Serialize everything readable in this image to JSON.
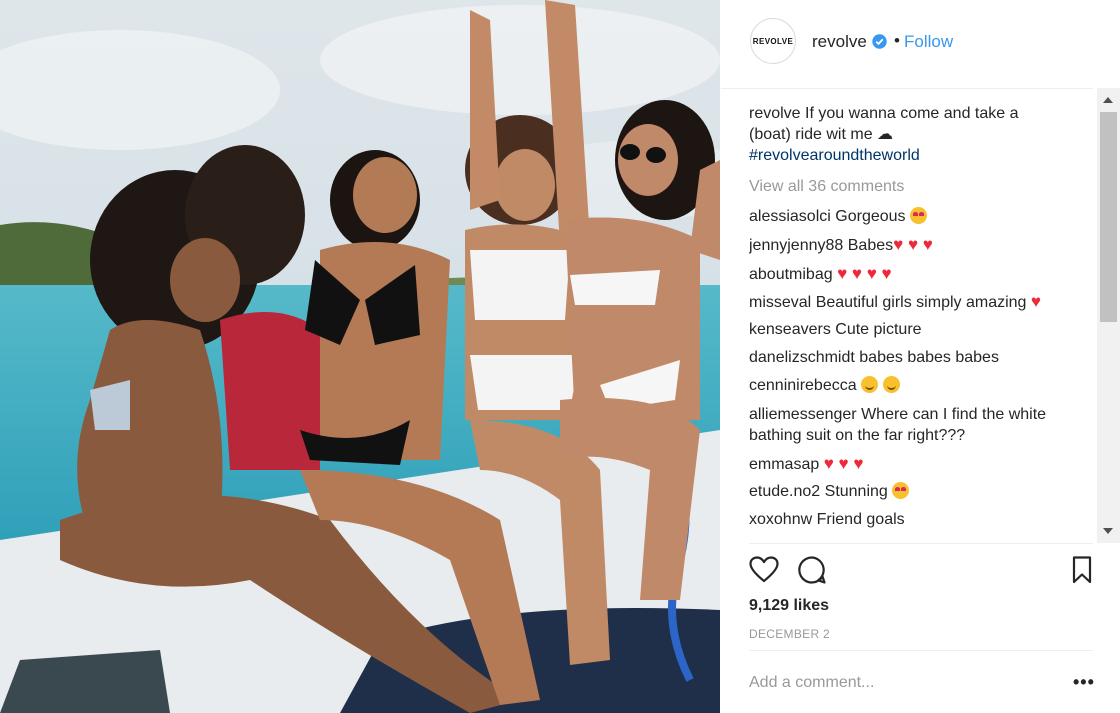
{
  "header": {
    "avatar_text": "REVOLVE",
    "username": "revolve",
    "dot": "•",
    "follow_label": "Follow"
  },
  "caption": {
    "username": "revolve",
    "text_line1": "If you wanna come and take a",
    "text_line2": "(boat) ride wit me ☁",
    "hashtag": "#revolvearoundtheworld"
  },
  "view_all_comments": "View all 36 comments",
  "comments": [
    {
      "user": "alessiasolci",
      "text": "Gorgeous",
      "emoji": "heart-eyes"
    },
    {
      "user": "jennyjenny88",
      "text": "Babes",
      "emoji": "hearts-3"
    },
    {
      "user": "aboutmibag",
      "text": "",
      "emoji": "hearts-4"
    },
    {
      "user": "misseval",
      "text": "Beautiful girls simply amazing",
      "emoji": "hearts-1"
    },
    {
      "user": "kenseavers",
      "text": "Cute picture",
      "emoji": ""
    },
    {
      "user": "danelizschmidt",
      "text": "babes babes babes",
      "emoji": ""
    },
    {
      "user": "cenninirebecca",
      "text": "",
      "emoji": "smiles-2"
    },
    {
      "user": "alliemessenger",
      "text": "Where can I find the white",
      "text2": "bathing suit on the far right???",
      "emoji": ""
    },
    {
      "user": "emmasap",
      "text": "",
      "emoji": "hearts-3"
    },
    {
      "user": "etude.no2",
      "text": "Stunning",
      "emoji": "heart-eyes"
    },
    {
      "user": "xoxohnw",
      "text": "Friend goals",
      "emoji": ""
    }
  ],
  "hearts": {
    "h1": "♥",
    "h2": "♥ ♥",
    "h3": "♥ ♥ ♥",
    "h4": "♥ ♥ ♥ ♥"
  },
  "likes": "9,129 likes",
  "date": "DECEMBER 2",
  "add_comment_placeholder": "Add a comment...",
  "more_options": "•••",
  "colors": {
    "link_blue": "#3897f0",
    "hashtag": "#003569",
    "muted": "#999999",
    "heart_red": "#ed2a39"
  }
}
